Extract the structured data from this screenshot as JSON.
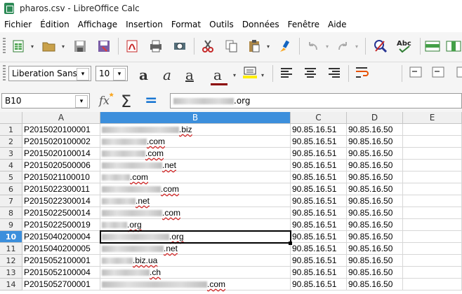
{
  "window": {
    "title": "pharos.csv - LibreOffice Calc"
  },
  "menu": [
    {
      "label": "Fichier"
    },
    {
      "label": "Édition"
    },
    {
      "label": "Affichage"
    },
    {
      "label": "Insertion"
    },
    {
      "label": "Format"
    },
    {
      "label": "Outils"
    },
    {
      "label": "Données"
    },
    {
      "label": "Fenêtre"
    },
    {
      "label": "Aide"
    }
  ],
  "toolbar2": {
    "font_name": "Liberation Sans",
    "font_size": "10"
  },
  "formula_bar": {
    "cell_ref": "B10",
    "content_suffix": ".org"
  },
  "columns": [
    "A",
    "B",
    "C",
    "D",
    "E"
  ],
  "rows": [
    {
      "num": "1",
      "a": "P2015020100001",
      "b": ".biz",
      "c": "90.85.16.51",
      "d": "90.85.16.50"
    },
    {
      "num": "2",
      "a": "P2015020100002",
      "b": ".com",
      "c": "90.85.16.51",
      "d": "90.85.16.50"
    },
    {
      "num": "3",
      "a": "P2015020100014",
      "b": ".com",
      "c": "90.85.16.51",
      "d": "90.85.16.50"
    },
    {
      "num": "4",
      "a": "P2015020500006",
      "b": ".net",
      "c": "90.85.16.51",
      "d": "90.85.16.50"
    },
    {
      "num": "5",
      "a": "P2015021100010",
      "b": ".com",
      "c": "90.85.16.51",
      "d": "90.85.16.50"
    },
    {
      "num": "6",
      "a": "P2015022300011",
      "b": ".com",
      "c": "90.85.16.51",
      "d": "90.85.16.50"
    },
    {
      "num": "7",
      "a": "P2015022300014",
      "b": ".net",
      "c": "90.85.16.51",
      "d": "90.85.16.50"
    },
    {
      "num": "8",
      "a": "P2015022500014",
      "b": ".com",
      "c": "90.85.16.51",
      "d": "90.85.16.50"
    },
    {
      "num": "9",
      "a": "P2015022500019",
      "b": ".org",
      "c": "90.85.16.51",
      "d": "90.85.16.50"
    },
    {
      "num": "10",
      "a": "P2015040200004",
      "b": ".org",
      "c": "90.85.16.51",
      "d": "90.85.16.50"
    },
    {
      "num": "11",
      "a": "P2015040200005",
      "b": ".net",
      "c": "90.85.16.51",
      "d": "90.85.16.50"
    },
    {
      "num": "12",
      "a": "P2015052100001",
      "b": ".biz.ua",
      "c": "90.85.16.51",
      "d": "90.85.16.50"
    },
    {
      "num": "13",
      "a": "P2015052100004",
      "b": ".ch",
      "c": "90.85.16.51",
      "d": "90.85.16.50"
    },
    {
      "num": "14",
      "a": "P2015052700001",
      "b": ".com",
      "c": "90.85.16.51",
      "d": "90.85.16.50"
    }
  ]
}
